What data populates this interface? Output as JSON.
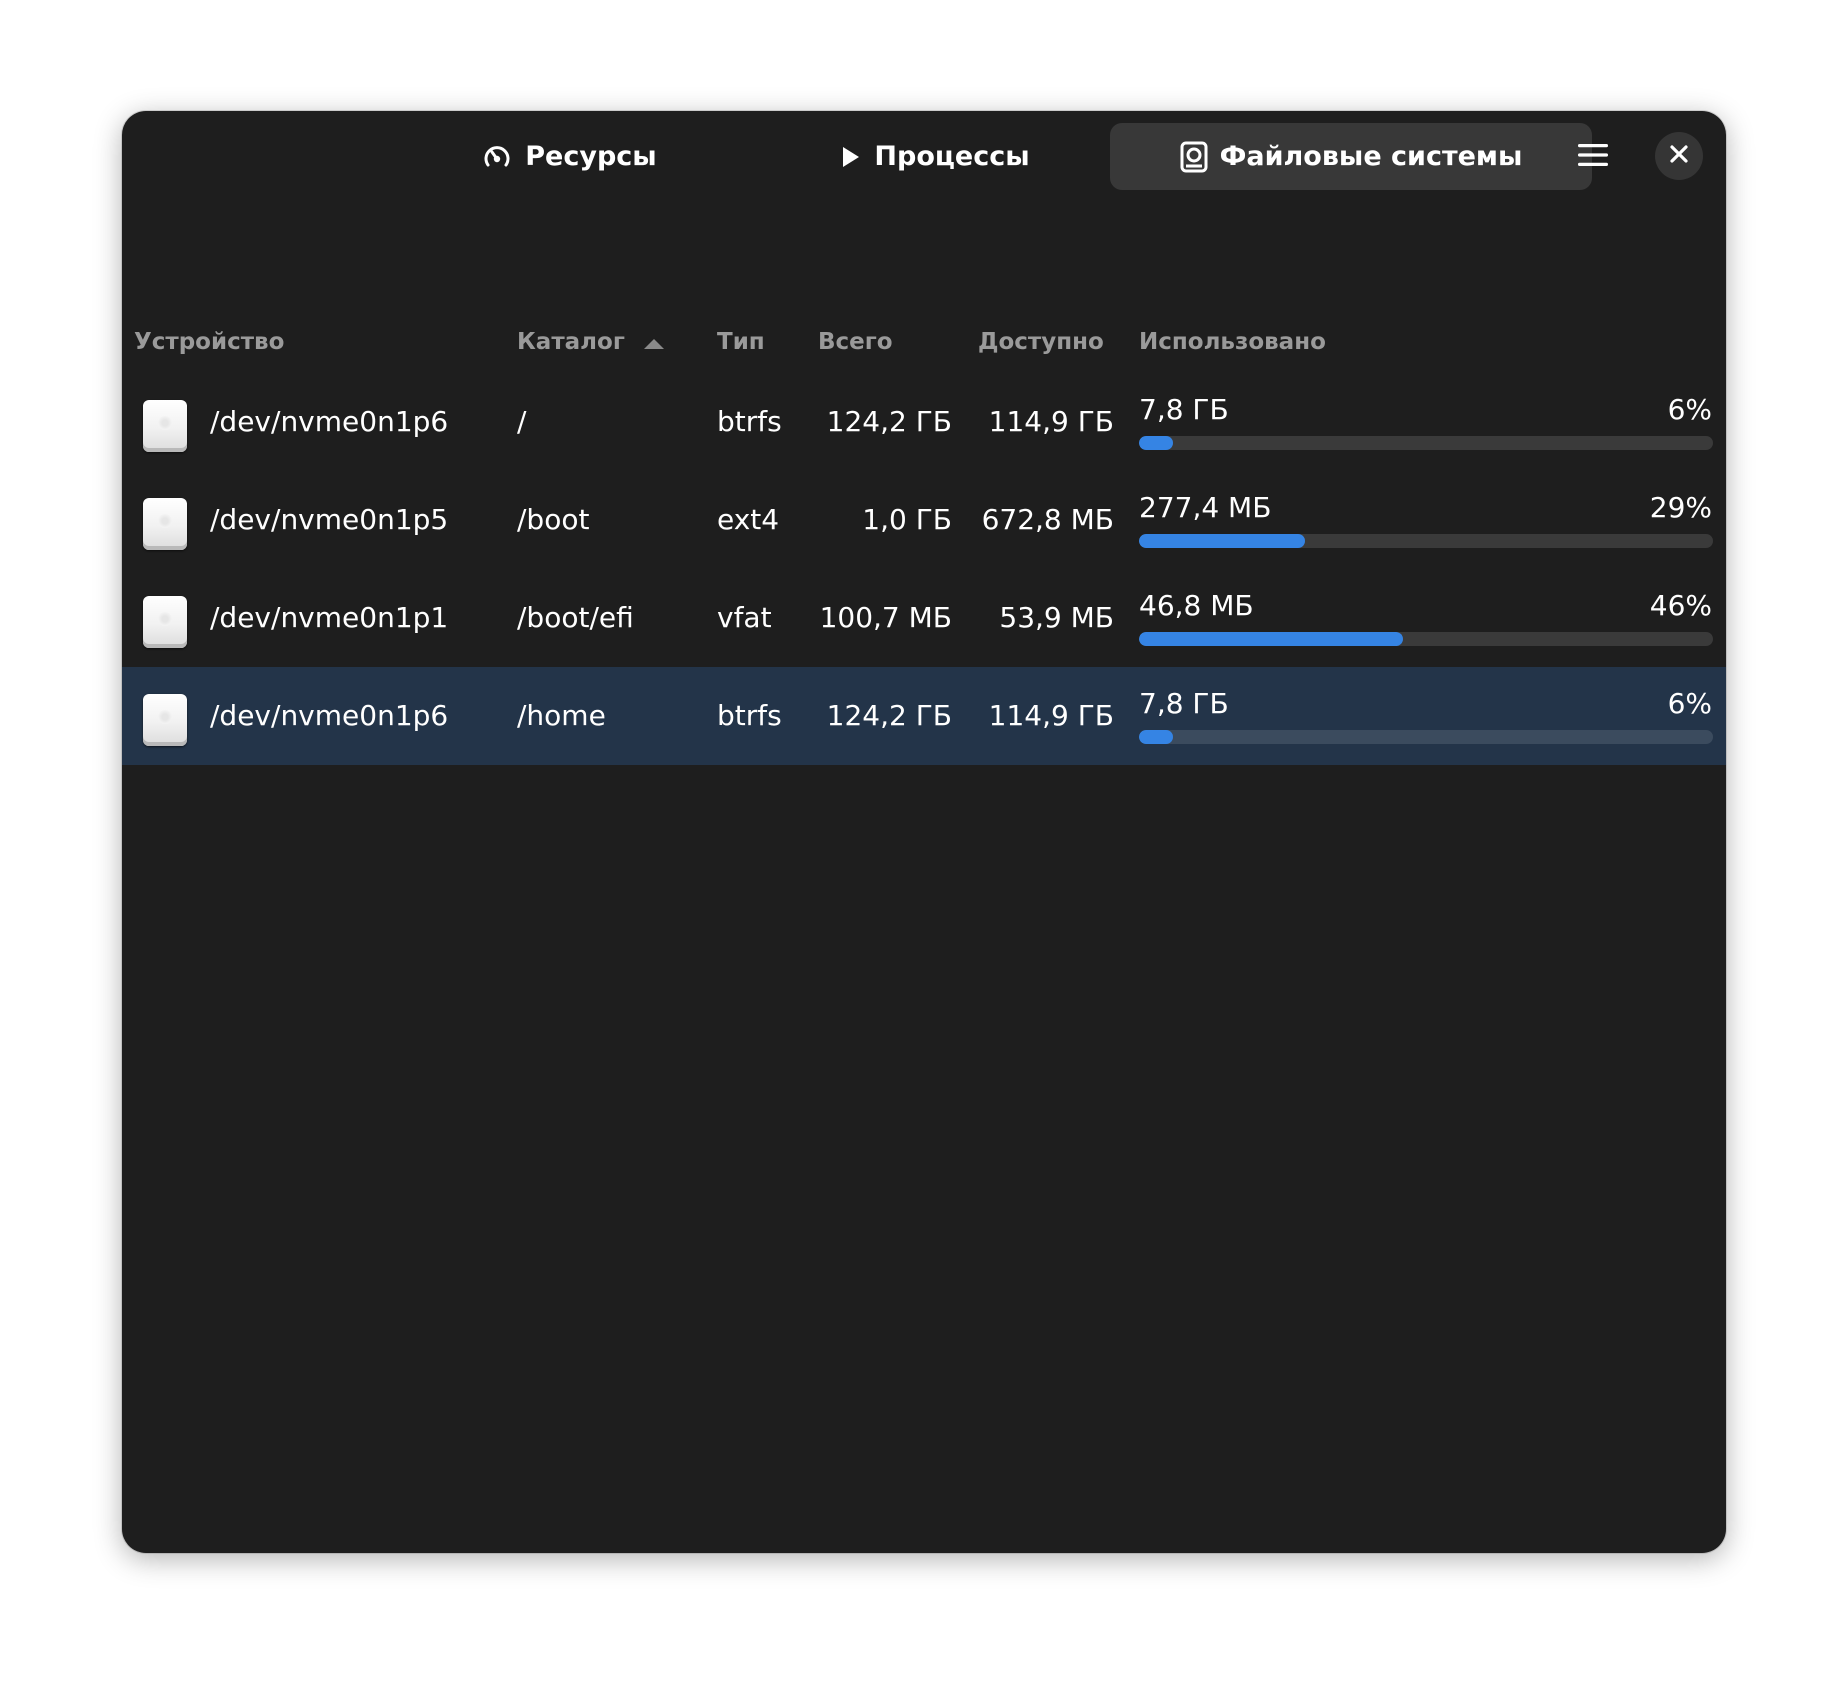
{
  "tabs": {
    "resources": "Ресурсы",
    "processes": "Процессы",
    "filesystems": "Файловые системы",
    "active": "filesystems"
  },
  "icons": {
    "resources": "gauge-icon",
    "processes": "play-icon",
    "filesystems": "drive-icon",
    "menu": "hamburger-menu-icon",
    "close": "close-icon",
    "sort": "sort-ascending-icon",
    "row": "drive-harddisk-icon"
  },
  "columns": {
    "device": "Устройство",
    "directory": "Каталог",
    "type": "Тип",
    "total": "Всего",
    "available": "Доступно",
    "used": "Использовано",
    "sorted_by": "directory",
    "sort_order": "ascending"
  },
  "rows": [
    {
      "device": "/dev/nvme0n1p6",
      "directory": "/",
      "type": "btrfs",
      "total": "124,2 ГБ",
      "available": "114,9 ГБ",
      "used": "7,8 ГБ",
      "percent": "6%",
      "fraction": 0.06,
      "selected": false
    },
    {
      "device": "/dev/nvme0n1p5",
      "directory": "/boot",
      "type": "ext4",
      "total": "1,0 ГБ",
      "available": "672,8 МБ",
      "used": "277,4 МБ",
      "percent": "29%",
      "fraction": 0.29,
      "selected": false
    },
    {
      "device": "/dev/nvme0n1p1",
      "directory": "/boot/efi",
      "type": "vfat",
      "total": "100,7 МБ",
      "available": "53,9 МБ",
      "used": "46,8 МБ",
      "percent": "46%",
      "fraction": 0.46,
      "selected": false
    },
    {
      "device": "/dev/nvme0n1p6",
      "directory": "/home",
      "type": "btrfs",
      "total": "124,2 ГБ",
      "available": "114,9 ГБ",
      "used": "7,8 ГБ",
      "percent": "6%",
      "fraction": 0.06,
      "selected": true
    }
  ],
  "colors": {
    "window_bg": "#1e1e1e",
    "accent": "#3584e4",
    "selection": "#233449",
    "header_text": "#9a9a9a"
  }
}
